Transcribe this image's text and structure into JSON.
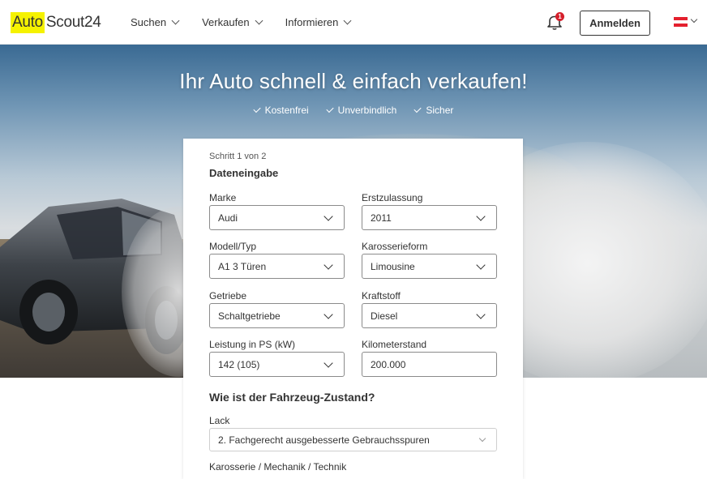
{
  "header": {
    "logo_auto": "Auto",
    "logo_scout": "Scout24",
    "nav": [
      {
        "label": "Suchen"
      },
      {
        "label": "Verkaufen"
      },
      {
        "label": "Informieren"
      }
    ],
    "notification_count": "1",
    "login_label": "Anmelden",
    "country_flag": "austria-flag-icon"
  },
  "hero": {
    "title": "Ihr Auto schnell & einfach verkaufen!",
    "usps": [
      "Kostenfrei",
      "Unverbindlich",
      "Sicher"
    ]
  },
  "form": {
    "step": "Schritt 1 von 2",
    "title": "Dateneingabe",
    "fields": {
      "marke": {
        "label": "Marke",
        "value": "Audi"
      },
      "erstzulassung": {
        "label": "Erstzulassung",
        "value": "2011"
      },
      "modell": {
        "label": "Modell/Typ",
        "value": "A1 3 Türen"
      },
      "karosserie": {
        "label": "Karosserieform",
        "value": "Limousine"
      },
      "getriebe": {
        "label": "Getriebe",
        "value": "Schaltgetriebe"
      },
      "kraftstoff": {
        "label": "Kraftstoff",
        "value": "Diesel"
      },
      "leistung": {
        "label": "Leistung in PS (kW)",
        "value": "142 (105)"
      },
      "kilometerstand": {
        "label": "Kilometerstand",
        "value": "200.000"
      }
    },
    "condition_title": "Wie ist der Fahrzeug-Zustand?",
    "lack": {
      "label": "Lack",
      "value": "2. Fachgerecht ausgebesserte Gebrauchsspuren"
    },
    "next_label": "Karosserie / Mechanik / Technik"
  },
  "colors": {
    "brand_yellow": "#f5f200",
    "badge_red": "#d51f2b",
    "text": "#333333"
  }
}
